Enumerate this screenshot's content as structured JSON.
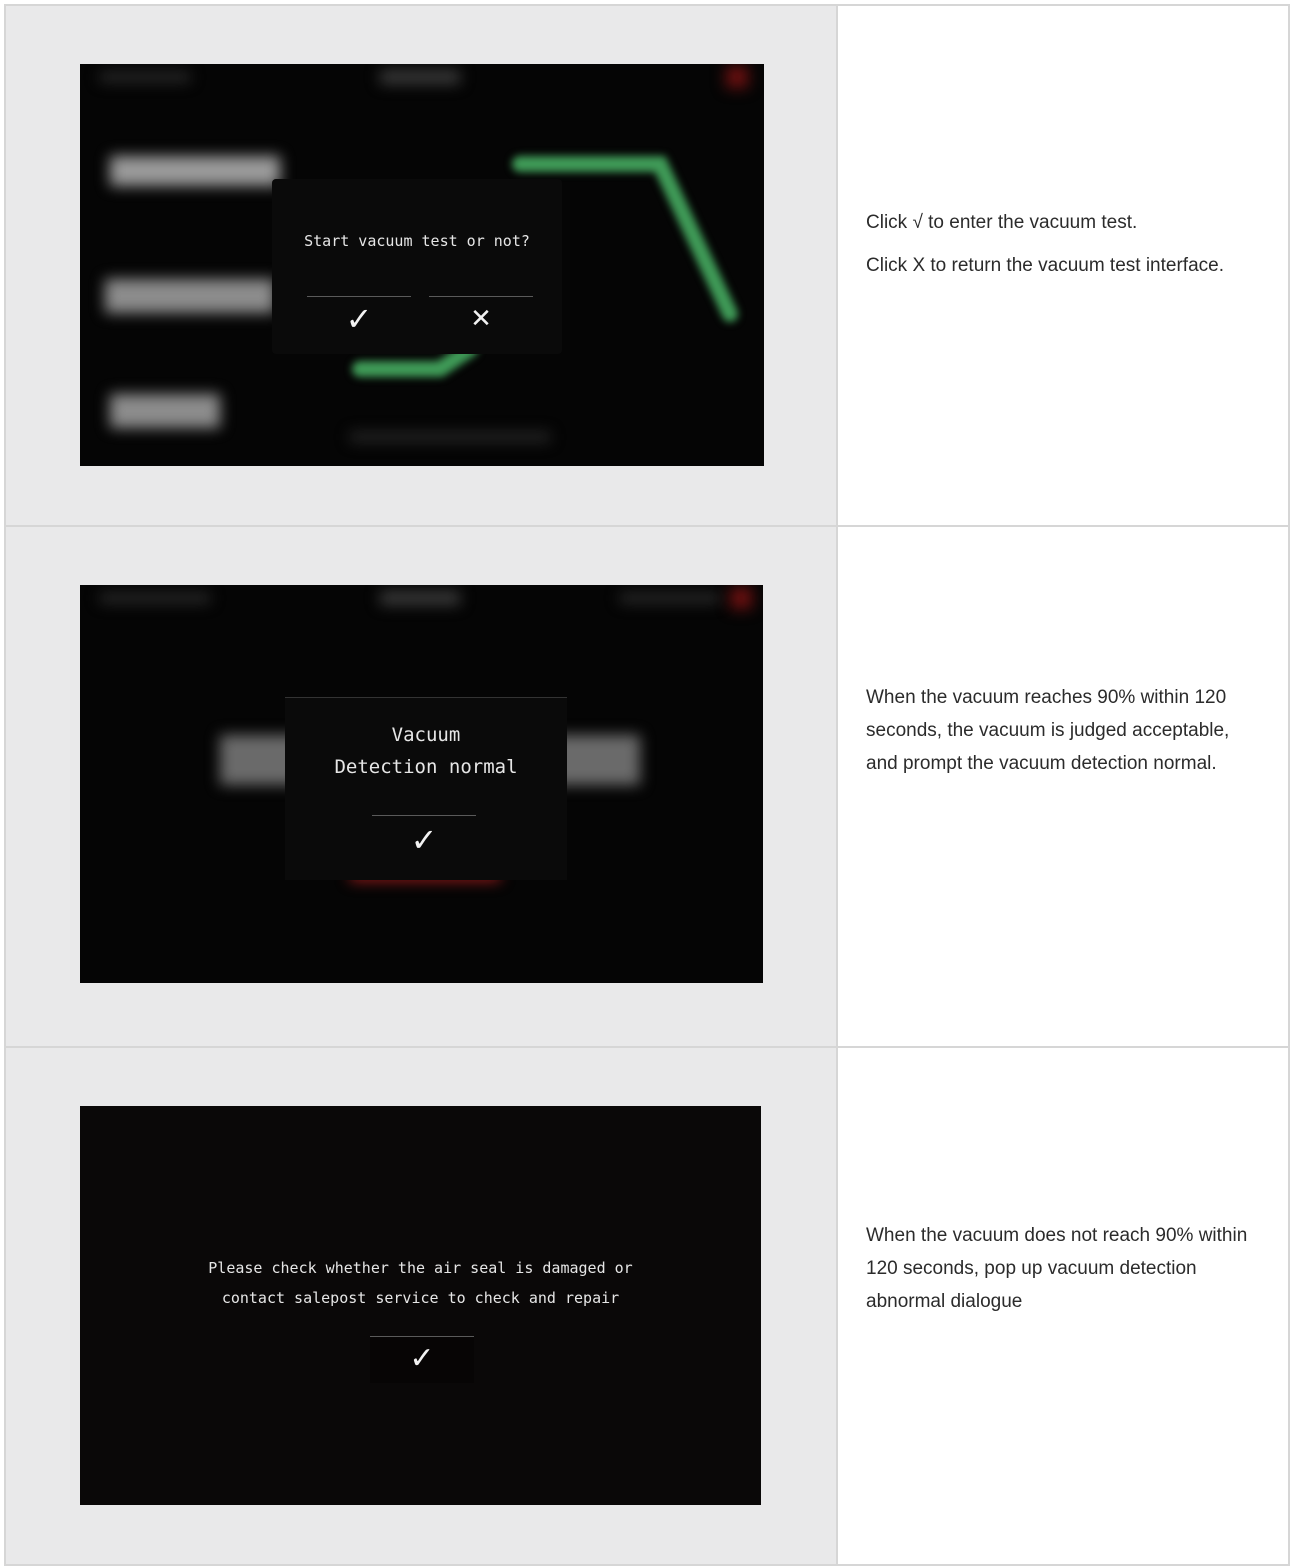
{
  "rows": [
    {
      "screen": {
        "dialog_text": "Start vacuum test or not?",
        "confirm_glyph": "✓",
        "cancel_glyph": "✕"
      },
      "description": [
        "Click √ to enter the vacuum test.",
        "Click X to return the vacuum test interface."
      ]
    },
    {
      "screen": {
        "dialog_line1": "Vacuum",
        "dialog_line2": "Detection normal",
        "confirm_glyph": "✓"
      },
      "description": [
        "When the vacuum reaches 90% within 120 seconds, the vacuum is judged acceptable, and prompt the vacuum detection normal."
      ]
    },
    {
      "screen": {
        "dialog_line1": "Please check whether the air seal is damaged or",
        "dialog_line2": "contact salepost service to check and repair",
        "confirm_glyph": "✓"
      },
      "description": [
        "When the vacuum does not reach 90% within 120 seconds, pop up vacuum detection abnormal dialogue"
      ]
    }
  ],
  "colors": {
    "image_cell_bg": "#e9e9ea",
    "border": "#d6d6d6",
    "screen_bg": "#050505",
    "accent_green": "#3f9a57",
    "accent_red": "#9a1a1a",
    "text": "#2b2b2b"
  }
}
